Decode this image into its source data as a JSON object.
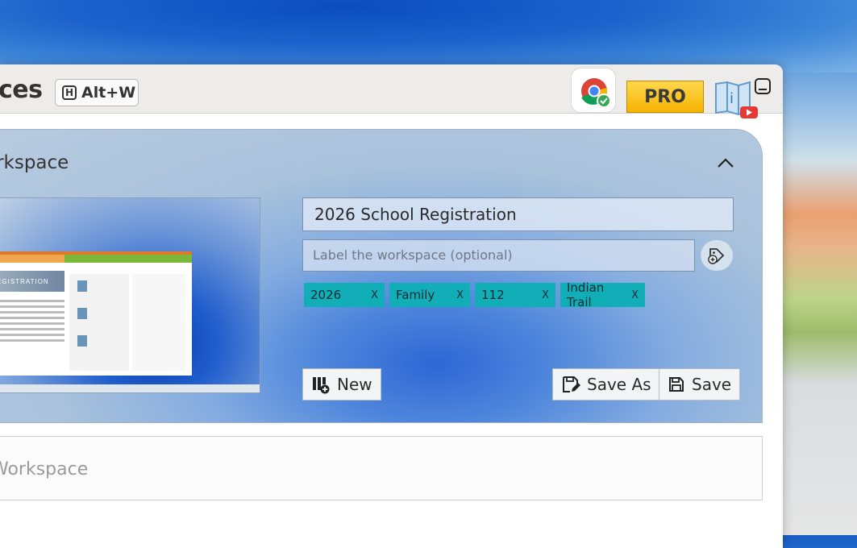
{
  "app": {
    "title": "ces",
    "shortcut_key": "H",
    "shortcut_label": "Alt+W",
    "pro_label": "PRO"
  },
  "panel": {
    "title": "orkspace",
    "name_value": "2026 School Registration",
    "label_placeholder": "Label the workspace (optional)",
    "tags": [
      {
        "label": "2026",
        "remove": "X"
      },
      {
        "label": "Family",
        "remove": "X"
      },
      {
        "label": "112",
        "remove": "X"
      },
      {
        "label": "Indian Trail",
        "remove": "X"
      }
    ],
    "thumbnail_banner": "REGISTRATION",
    "buttons": {
      "new": "New",
      "save_as": "Save As",
      "save": "Save"
    }
  },
  "lower_panel": {
    "title": "Workspace"
  },
  "icons": {
    "minimize": "minimize-icon",
    "collapse": "chevron-up-icon",
    "chrome": "chrome-check-icon",
    "video": "video-help-icon",
    "add_tag": "tag-add-icon",
    "new": "new-workspace-icon",
    "save_as": "save-as-icon",
    "save": "save-icon"
  },
  "colors": {
    "tag_bg": "#12aeb8",
    "pro_gold": "#f5b300"
  }
}
